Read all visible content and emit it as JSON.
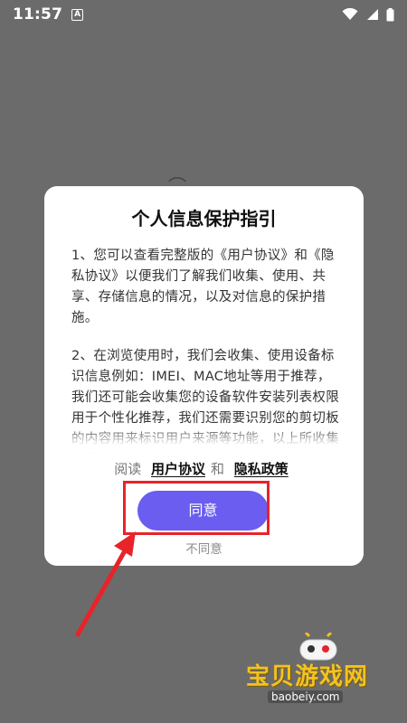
{
  "status_bar": {
    "time": "11:57",
    "notification_letter": "A",
    "icons": [
      "wifi-icon",
      "cellular-signal-icon",
      "battery-icon"
    ]
  },
  "dialog": {
    "title": "个人信息保护指引",
    "paragraphs": [
      "1、您可以查看完整版的《用户协议》和《隐私协议》以便我们了解我们收集、使用、共享、存储信息的情况，以及对信息的保护措施。",
      "2、在浏览使用时，我们会收集、使用设备标识信息例如：IMEI、MAC地址等用于推荐，我们还可能会收集您的设备软件安装列表权限用于个性化推荐，我们还需要识别您的剪切板的内容用来标识用户来源等功能，以上所收集信息"
    ],
    "read_prefix": "阅读",
    "user_agreement_link": "用户协议",
    "and_word": "和",
    "privacy_policy_link": "隐私政策",
    "agree_label": "同意",
    "disagree_label": "不同意"
  },
  "watermark": {
    "brand": "宝贝游戏网",
    "url": "baobeiy.com"
  },
  "colors": {
    "overlay_bg": "#6b6b6b",
    "accent": "#6a5df0",
    "annotation_red": "#e8232a",
    "watermark_yellow": "#f4c21f"
  }
}
